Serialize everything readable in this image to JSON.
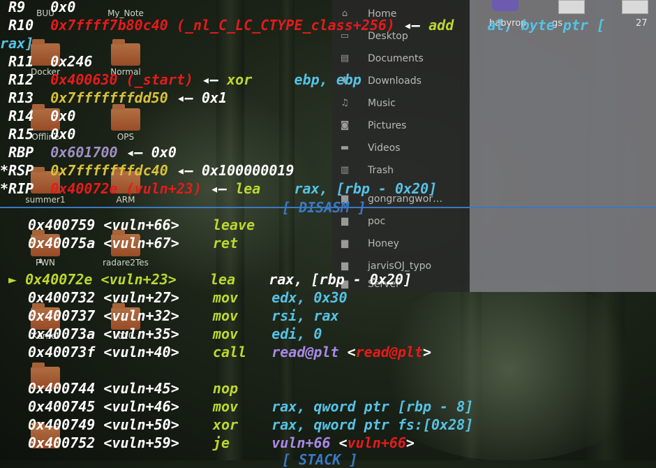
{
  "desktop": {
    "icons": [
      "BUU",
      "My_Note",
      "Docker",
      "Normal",
      "Offline",
      "OPS",
      "summer1",
      "ARM",
      "PWN",
      "radare2Tes",
      "Kernel",
      "010"
    ]
  },
  "file_manager": {
    "places": [
      "Home",
      "Desktop",
      "Documents",
      "Downloads",
      "Music",
      "Pictures",
      "Videos",
      "Trash"
    ],
    "bookmarks": [
      "gongrangwor…",
      "poc",
      "Honey",
      "jarvisOJ_typo",
      "Server"
    ],
    "files": [
      "babyrop",
      "gs",
      "27"
    ]
  },
  "registers": [
    {
      "name": " R9 ",
      "value": "0x0",
      "color": "w"
    },
    {
      "name": " R10",
      "value": "0x7ffff7b80c40 (_nl_C_LC_CTYPE_class+256)",
      "color": "r",
      "arrow": "◂— ",
      "insn": "add",
      "ops": "al, byte ptr ["
    },
    {
      "name": " R11",
      "value": "0x246",
      "color": "w"
    },
    {
      "name": " R12",
      "value": "0x400630 (_start)",
      "color": "r",
      "arrow": "◂— ",
      "insn": "xor",
      "ops": "ebp, ebp"
    },
    {
      "name": " R13",
      "value": "0x7fffffffdd50",
      "color": "y",
      "arrow": "◂— ",
      "extra": "0x1"
    },
    {
      "name": " R14",
      "value": "0x0",
      "color": "w"
    },
    {
      "name": " R15",
      "value": "0x0",
      "color": "w"
    },
    {
      "name": " RBP",
      "value": "0x601700",
      "color": "gr",
      "arrow": "◂— ",
      "extra": "0x0"
    },
    {
      "name": "*RSP",
      "value": "0x7fffffffdc40",
      "color": "y",
      "arrow": "◂— ",
      "extra": "0x100000019"
    },
    {
      "name": "*RIP",
      "value": "0x40072e (vuln+23)",
      "color": "r",
      "arrow": "◂— ",
      "insn": "lea",
      "ops": "rax, [rbp - 0x20]"
    }
  ],
  "r10_wrap": "rax]",
  "disasm_header": "[ DISASM ]",
  "stack_header": "[ STACK ]",
  "current_marker": "►",
  "disasm": [
    {
      "addr": "0x400759",
      "sym": "<vuln+66>",
      "mn": "leave",
      "ops": ""
    },
    {
      "addr": "0x40075a",
      "sym": "<vuln+67>",
      "mn": "ret",
      "ops": ""
    },
    {
      "addr": "0x40072e",
      "sym": "<vuln+23>",
      "mn": "lea",
      "ops": "rax, [rbp - 0x20]",
      "current": true
    },
    {
      "addr": "0x400732",
      "sym": "<vuln+27>",
      "mn": "mov",
      "ops": "edx, 0x30"
    },
    {
      "addr": "0x400737",
      "sym": "<vuln+32>",
      "mn": "mov",
      "ops": "rsi, rax"
    },
    {
      "addr": "0x40073a",
      "sym": "<vuln+35>",
      "mn": "mov",
      "ops": "edi, 0"
    },
    {
      "addr": "0x40073f",
      "sym": "<vuln+40>",
      "mn": "call",
      "ops": "read@plt",
      "target": "read@plt"
    },
    {
      "addr": "0x400744",
      "sym": "<vuln+45>",
      "mn": "nop",
      "ops": ""
    },
    {
      "addr": "0x400745",
      "sym": "<vuln+46>",
      "mn": "mov",
      "ops": "rax, qword ptr [rbp - 8]"
    },
    {
      "addr": "0x400749",
      "sym": "<vuln+50>",
      "mn": "xor",
      "ops": "rax, qword ptr fs:[0x28]"
    },
    {
      "addr": "0x400752",
      "sym": "<vuln+59>",
      "mn": "je",
      "ops": "vuln+66",
      "target": "vuln+66"
    }
  ]
}
